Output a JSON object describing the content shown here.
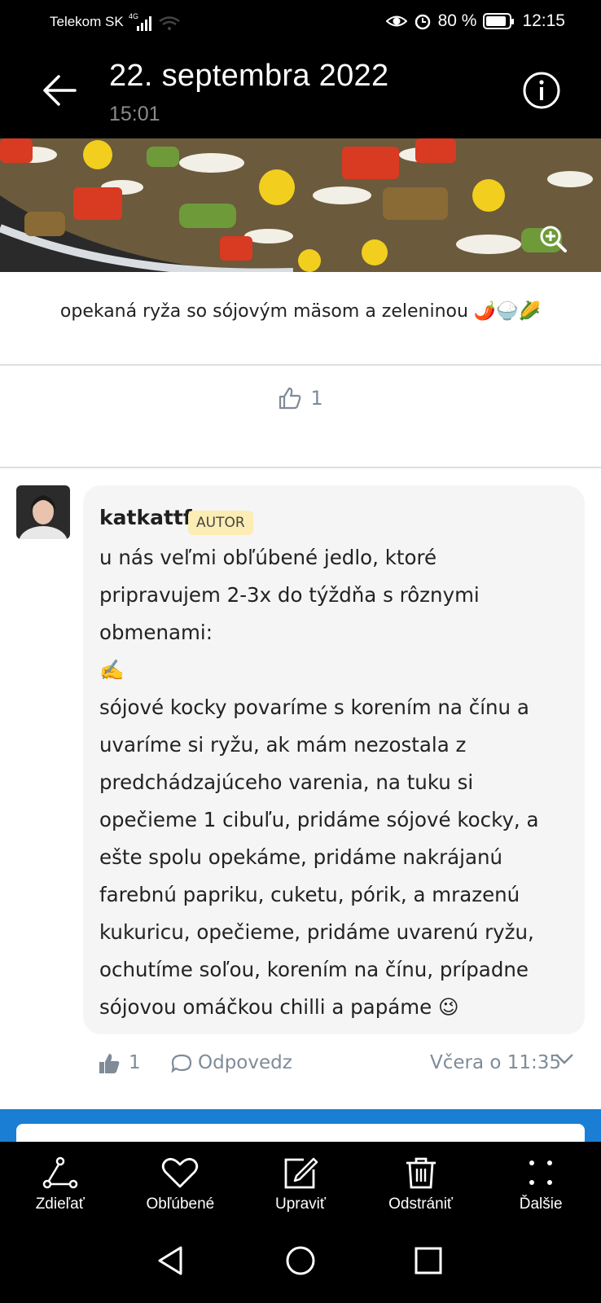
{
  "status_bar": {
    "carrier": "Telekom SK",
    "network": "4G",
    "battery": "80 %",
    "clock": "12:15"
  },
  "header": {
    "date": "22. septembra 2022",
    "time": "15:01"
  },
  "post": {
    "caption": "opekaná ryža so sójovým mäsom a zeleninou 🌶️🍚🌽",
    "likes": "1"
  },
  "comment": {
    "author": "katkattf",
    "badge": "AUTOR",
    "text": "u nás veľmi obľúbené jedlo, ktoré\npripravujem 2-3x do týždňa s rôznymi\nobmenami:\n✍️\nsójové kocky povaríme s korením na čínu a\nuvaríme si ryžu, ak mám nezostala z\npredchádzajúceho varenia, na tuku si\nopečieme 1 cibuľu, pridáme sójové kocky, a\nešte spolu opekáme, pridáme nakrájanú\nfarebnú papriku, cuketu, pórik, a mrazenú\nkukuricu, opečieme, pridáme uvarenú ryžu,\nochutíme soľou, korením na čínu, prípadne\nsójovou omáčkou chilli a papáme 😉",
    "likes": "1",
    "reply_label": "Odpovedz",
    "timestamp": "Včera o 11:35"
  },
  "toolbar": {
    "share": "Zdieľať",
    "favorite": "Obľúbené",
    "edit": "Upraviť",
    "delete": "Odstrániť",
    "more": "Ďalšie"
  },
  "colors": {
    "accent_blue": "#1a7fd4",
    "badge_bg": "#fbedb3",
    "muted_text": "#7f8b99"
  }
}
